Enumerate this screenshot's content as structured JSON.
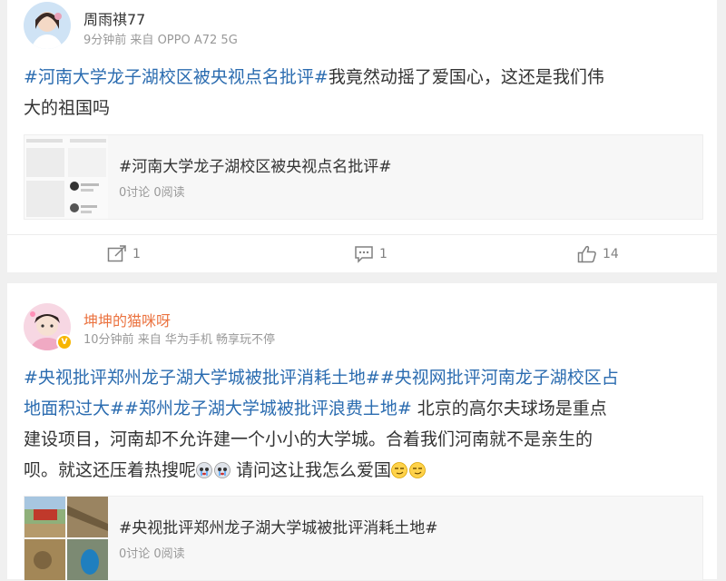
{
  "posts": [
    {
      "username": "周雨祺77",
      "time": "9分钟前",
      "source_prefix": "来自",
      "source": "OPPO A72 5G",
      "topic": "#河南大学龙子湖校区被央视点名批评#",
      "text_line1": "我竟然动摇了爱国心，这还是我们伟",
      "text_line2": "大的祖国吗",
      "ref_title": "#河南大学龙子湖校区被央视点名批评#",
      "ref_stats": "0讨论 0阅读",
      "actions": {
        "repost": "1",
        "comment": "1",
        "like": "14"
      }
    },
    {
      "username": "坤坤的猫咪呀",
      "time": "10分钟前",
      "source_prefix": "来自",
      "source": "华为手机 畅享玩不停",
      "verified_badge": "V",
      "line1_topic_a": "#央视批评郑州龙子湖大学城被批评消耗土地#",
      "line1_topic_b": "#央视网批评河南龙子湖校区占",
      "line2_topic_b": "地面积过大#",
      "line2_topic_c": "#郑州龙子湖大学城被批评浪费土地#",
      "line2_text": " 北京的高尔夫球场是重点",
      "line3_text": "建设项目，河南却不允许建一个小小的大学城。合着我们河南就不是亲生的",
      "line4_text_a": "呗。就这还压着热搜呢",
      "line4_text_b": " 请问这让我怎么爱国",
      "ref_title": "#央视批评郑州龙子湖大学城被批评消耗土地#",
      "ref_stats": "0讨论 0阅读"
    }
  ],
  "icons": {
    "repost": "repost-icon",
    "comment": "comment-icon",
    "like": "like-icon",
    "crying": "crying-emoji-icon",
    "smirk": "smirk-emoji-icon"
  },
  "colors": {
    "topic": "#2b6cb0",
    "username_orange": "#eb7340",
    "meta": "#999999"
  }
}
